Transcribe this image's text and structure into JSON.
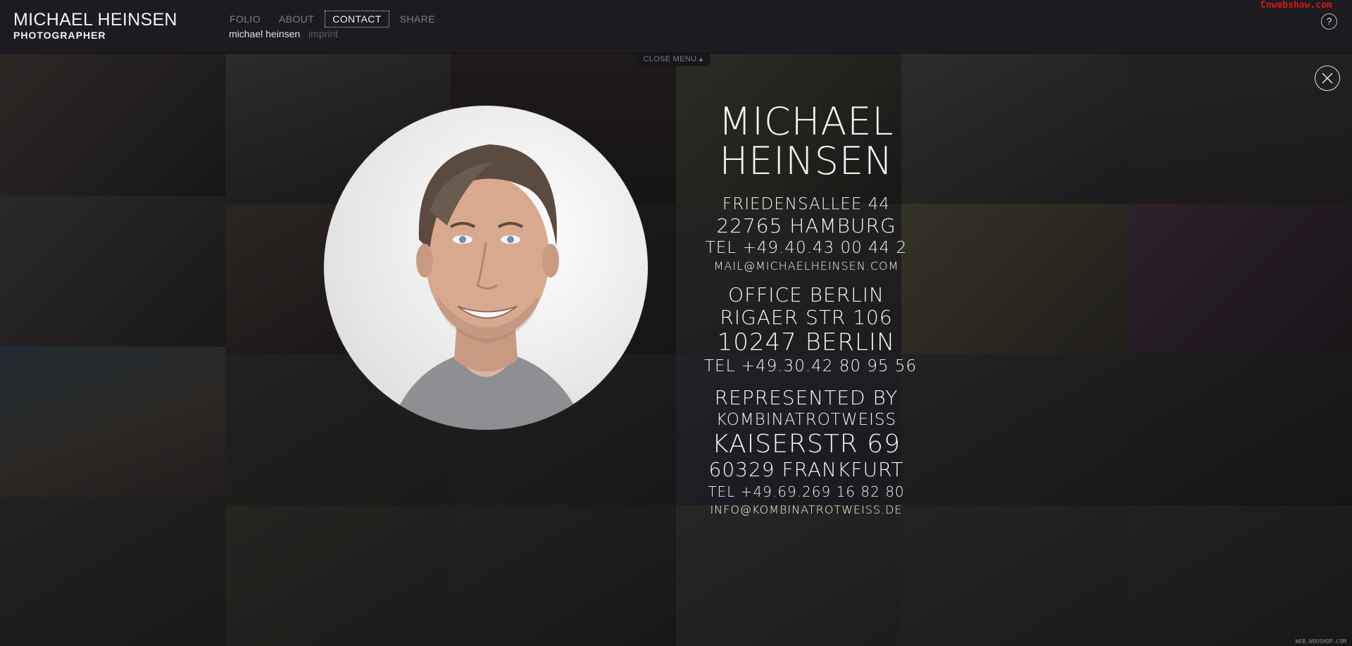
{
  "header": {
    "brand_name": "MICHAEL HEINSEN",
    "brand_role": "PHOTOGRAPHER",
    "nav": [
      {
        "label": "FOLIO",
        "active": false
      },
      {
        "label": "ABOUT",
        "active": false
      },
      {
        "label": "CONTACT",
        "active": true
      },
      {
        "label": "SHARE",
        "active": false
      }
    ],
    "subnav_active": "michael heinsen",
    "subnav_other": "imprint",
    "watermark": "Cnwebshow.com",
    "help_label": "?"
  },
  "close_menu": {
    "label": "CLOSE MENU"
  },
  "contact": {
    "name_first": "MICHAEL",
    "name_last": "HEINSEN",
    "hamburg": {
      "street": "FRIEDENSALLEE 44",
      "city": "22765 HAMBURG",
      "tel": "TEL +49.40.43 00 44 2",
      "email": "MAIL@MICHAELHEINSEN.COM"
    },
    "berlin": {
      "title": "OFFICE BERLIN",
      "street": "RIGAER STR 106",
      "city": "10247 BERLIN",
      "tel": "TEL +49.30.42 80 95 56"
    },
    "agency": {
      "title": "REPRESENTED BY",
      "name": "KOMBINATROTWEISS",
      "street": "KAISERSTR 69",
      "city": "60329 FRANKFURT",
      "tel": "TEL +49.69.269 16 82 80",
      "email": "INFO@KOMBINATROTWEISS.DE"
    }
  },
  "footer_mark": "WEB.WOOSHOP.COM",
  "colors": {
    "header_bg": "#1c1b20",
    "text": "#f4f4f4",
    "nav_dim": "#7d7c82",
    "watermark": "#d81818"
  }
}
